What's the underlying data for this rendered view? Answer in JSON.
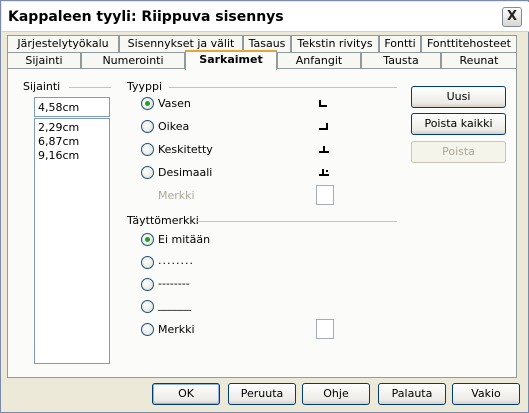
{
  "window": {
    "title": "Kappaleen tyyli: Riippuva sisennys",
    "close_label": "X"
  },
  "tabs_row1": [
    {
      "label": "Järjestelytyökalu"
    },
    {
      "label": "Sisennykset ja välit"
    },
    {
      "label": "Tasaus"
    },
    {
      "label": "Tekstin rivitys"
    },
    {
      "label": "Fontti"
    },
    {
      "label": "Fonttitehosteet"
    }
  ],
  "tabs_row2": [
    {
      "label": "Sijainti"
    },
    {
      "label": "Numerointi"
    },
    {
      "label": "Sarkaimet",
      "active": true
    },
    {
      "label": "Anfangit"
    },
    {
      "label": "Tausta"
    },
    {
      "label": "Reunat"
    }
  ],
  "position": {
    "header": "Sijainti",
    "input_value": "4,58cm",
    "items": [
      "2,29cm",
      "6,87cm",
      "9,16cm"
    ]
  },
  "type": {
    "header": "Tyyppi",
    "options": [
      {
        "label": "Vasen",
        "checked": true,
        "icon": "tab-left-icon"
      },
      {
        "label": "Oikea",
        "checked": false,
        "icon": "tab-right-icon"
      },
      {
        "label": "Keskitetty",
        "checked": false,
        "icon": "tab-center-icon"
      },
      {
        "label": "Desimaali",
        "checked": false,
        "icon": "tab-decimal-icon"
      }
    ],
    "char_label": "Merkki"
  },
  "fill": {
    "header": "Täyttömerkki",
    "options": [
      {
        "label": "Ei mitään",
        "checked": true
      },
      {
        "label": "........",
        "checked": false
      },
      {
        "label": "--------",
        "checked": false
      },
      {
        "label": "______",
        "checked": false
      },
      {
        "label": "Merkki",
        "checked": false
      }
    ]
  },
  "side_buttons": {
    "new": "Uusi",
    "delete_all": "Poista kaikki",
    "delete": "Poista"
  },
  "footer": {
    "ok": "OK",
    "cancel": "Peruuta",
    "help": "Ohje",
    "reset": "Palauta",
    "standard": "Vakio"
  },
  "colors": {
    "active_tab_accent": "#e5a53a",
    "radio_checked": "#21a121",
    "dialog_bg": "#ece9d8"
  }
}
